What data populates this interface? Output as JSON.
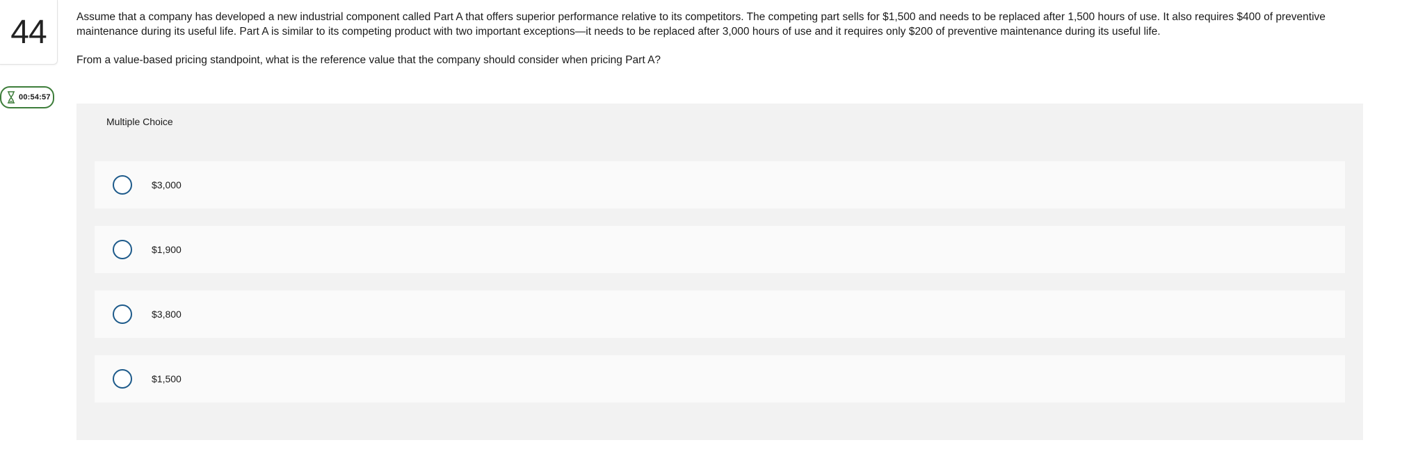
{
  "question_number": "44",
  "timer": {
    "icon": "hourglass-icon",
    "text": "00:54:57",
    "border_color": "#3d7d3a"
  },
  "question": {
    "body": "Assume that a company has developed a new industrial component called Part A that offers superior performance relative to its competitors. The competing part sells for $1,500 and needs to be replaced after 1,500 hours of use. It also requires $400 of preventive maintenance during its useful life. Part A is similar to its competing product with two important exceptions—it needs to be replaced after 3,000 hours of use and it requires only $200 of preventive maintenance during its useful life.",
    "prompt": "From a value-based pricing standpoint, what is the reference value that the company should consider when pricing Part A?"
  },
  "multiple_choice": {
    "header": "Multiple Choice",
    "radio_color": "#1d5a8a",
    "options": [
      {
        "label": "$3,000"
      },
      {
        "label": "$1,900"
      },
      {
        "label": "$3,800"
      },
      {
        "label": "$1,500"
      }
    ]
  }
}
